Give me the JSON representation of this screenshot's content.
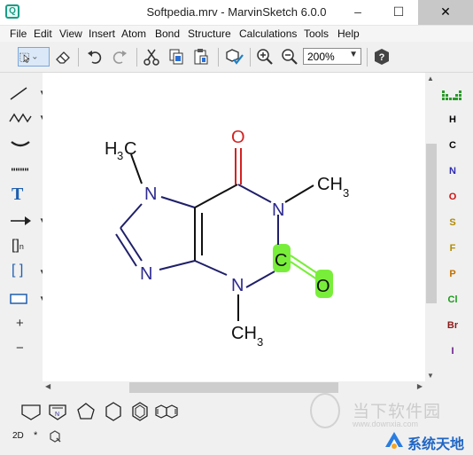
{
  "window": {
    "title": "Softpedia.mrv - MarvinSketch 6.0.0",
    "minimize": "–",
    "maximize": "☐",
    "close": "✕",
    "app_icon": "Q"
  },
  "menu": [
    "File",
    "Edit",
    "View",
    "Insert",
    "Atom",
    "Bond",
    "Structure",
    "Calculations",
    "Tools",
    "Help"
  ],
  "toolbar": {
    "zoom_value": "200%",
    "icons": [
      "selection-arrow-icon",
      "eraser-icon",
      "undo-icon",
      "redo-icon",
      "cut-icon",
      "copy-icon",
      "paste-icon",
      "clean-icon",
      "zoom-in-icon",
      "zoom-out-icon",
      "help-icon"
    ]
  },
  "left_tools": {
    "text_tool": "T",
    "bracket_tool": "[]",
    "bracket_subscript": "n",
    "group_bracket_tool": "[ ]",
    "plus": "+",
    "minus": "−"
  },
  "molecule": {
    "atoms": {
      "ch3_top_h": "H",
      "ch3_top_3": "3",
      "ch3_top_c": "C",
      "n_top": "N",
      "o_top": "O",
      "n_right": "N",
      "ch3_right": "CH",
      "ch3_right_3": "3",
      "c_highlight": "C",
      "o_highlight": "O",
      "n_bottom_left": "N",
      "n_bottom": "N",
      "ch3_bottom": "CH",
      "ch3_bottom_3": "3"
    },
    "colors": {
      "nitrogen": "#2e2a8f",
      "oxygen": "#d32222",
      "bond": "#111111",
      "highlight": "#79ee3a"
    }
  },
  "periodic": {
    "elements": [
      {
        "symbol": "H",
        "color": "#000000"
      },
      {
        "symbol": "C",
        "color": "#000000"
      },
      {
        "symbol": "N",
        "color": "#2e2ab0"
      },
      {
        "symbol": "O",
        "color": "#d01010"
      },
      {
        "symbol": "S",
        "color": "#b08a00"
      },
      {
        "symbol": "F",
        "color": "#b08a00"
      },
      {
        "symbol": "P",
        "color": "#c07000"
      },
      {
        "symbol": "Cl",
        "color": "#1a9a1a"
      },
      {
        "symbol": "Br",
        "color": "#8b1a1a"
      },
      {
        "symbol": "I",
        "color": "#6a1a8b"
      }
    ]
  },
  "status": {
    "mode": "2D",
    "star": "*"
  },
  "watermark": {
    "softpedia_text": "当下软件园",
    "softpedia_url": "www.downxia.com",
    "xitong_text": "系统天地"
  }
}
